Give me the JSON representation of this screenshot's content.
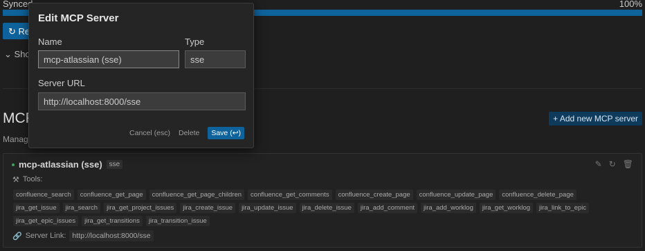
{
  "background": {
    "sync_label": "Synced",
    "sync_percent": "100%",
    "sync_progress": 1.0,
    "refresh_button": "Re",
    "show_toggle": "Sho",
    "section_heading": "MCP",
    "manage_text": "Manag",
    "add_server_button": "+ Add new MCP server",
    "server_card": {
      "name": "mcp-atlassian (sse)",
      "type_badge": "sse",
      "tools_label": "Tools:",
      "tools": [
        "confluence_search",
        "confluence_get_page",
        "confluence_get_page_children",
        "confluence_get_comments",
        "confluence_create_page",
        "confluence_update_page",
        "confluence_delete_page",
        "jira_get_issue",
        "jira_search",
        "jira_get_project_issues",
        "jira_create_issue",
        "jira_update_issue",
        "jira_delete_issue",
        "jira_add_comment",
        "jira_add_worklog",
        "jira_get_worklog",
        "jira_link_to_epic",
        "jira_get_epic_issues",
        "jira_get_transitions",
        "jira_transition_issue"
      ],
      "server_link_label": "Server Link:",
      "server_link_url": "http://localhost:8000/sse"
    }
  },
  "modal": {
    "title": "Edit MCP Server",
    "name_label": "Name",
    "name_value": "mcp-atlassian (sse)",
    "type_label": "Type",
    "type_value": "sse",
    "url_label": "Server URL",
    "url_value": "http://localhost:8000/sse",
    "cancel_label": "Cancel (esc)",
    "delete_label": "Delete",
    "save_label": "Save (↩)"
  }
}
